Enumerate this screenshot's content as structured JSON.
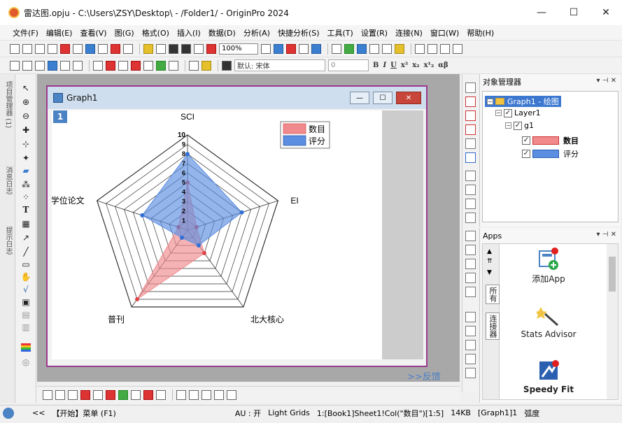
{
  "window": {
    "title": "雷达图.opju - C:\\Users\\ZSY\\Desktop\\ - /Folder1/ - OriginPro 2024",
    "minimize": "—",
    "maximize": "☐",
    "close": "✕"
  },
  "menu": [
    "文件(F)",
    "编辑(E)",
    "查看(V)",
    "图(G)",
    "格式(O)",
    "插入(I)",
    "数据(D)",
    "分析(A)",
    "快捷分析(S)",
    "工具(T)",
    "设置(R)",
    "连接(N)",
    "窗口(W)",
    "帮助(H)"
  ],
  "toolbar": {
    "zoom": "100%",
    "font_label": "默认: 宋体",
    "font_size": "0",
    "bold": "B",
    "italic": "I",
    "underline": "U",
    "greek": "αβ"
  },
  "left_dock_tabs": [
    "项目管理器 (1)",
    "消息日志",
    "提示日志"
  ],
  "graph_window": {
    "title": "Graph1",
    "layer_number": "1",
    "minimize": "—",
    "restore": "☐",
    "close": "✕"
  },
  "chart_data": {
    "type": "radar",
    "axes": [
      "SCI",
      "EI",
      "北大核心",
      "普刊",
      "学位论文"
    ],
    "rmax": 10,
    "ticks": [
      "1",
      "2",
      "3",
      "4",
      "5",
      "6",
      "7",
      "8",
      "9",
      "10"
    ],
    "series": [
      {
        "name": "数目",
        "values": [
          5,
          1,
          3,
          9,
          1
        ],
        "color": "#f08a8d"
      },
      {
        "name": "评分",
        "values": [
          8,
          6,
          2,
          1,
          5
        ],
        "color": "#5b8ee0"
      }
    ],
    "legend_position": "top-right"
  },
  "feedback_link": ">>反馈",
  "object_manager": {
    "title": "对象管理器",
    "pin": "▾ ⊣ ✕",
    "graph_node": "Graph1 - 绘图",
    "layer_node": "Layer1",
    "group_node": "g1",
    "plots": [
      {
        "label": "数目",
        "color": "#f08a8d"
      },
      {
        "label": "评分",
        "color": "#5b8ee0"
      }
    ]
  },
  "apps": {
    "title": "Apps",
    "pin": "▾ ⊣ ✕",
    "tabs": [
      "所有",
      "连接器"
    ],
    "items": [
      "添加App",
      "Stats Advisor",
      "Speedy Fit"
    ]
  },
  "status": {
    "prefix": "<<",
    "start": "【开始】菜单 (F1)",
    "au": "AU : 开",
    "grids": "Light Grids",
    "cell": "1:[Book1]Sheet1!Col(\"数目\")[1:5]",
    "size": "14KB",
    "graph": "[Graph1]1",
    "unit": "弧度"
  }
}
